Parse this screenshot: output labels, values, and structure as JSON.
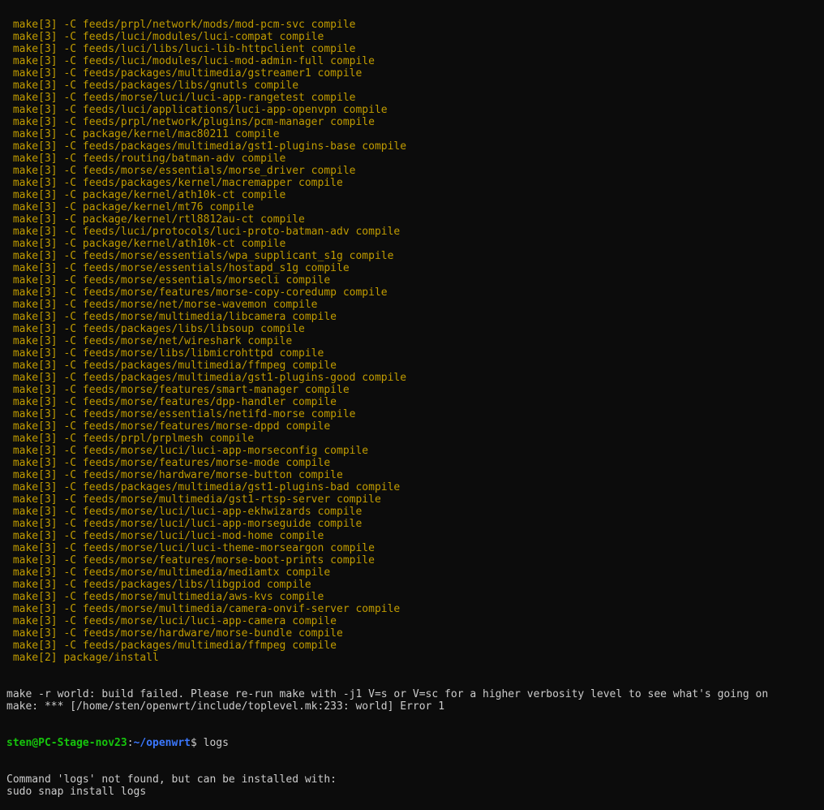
{
  "terminal": {
    "build_lines": [
      " make[3] -C feeds/prpl/network/mods/mod-pcm-svc compile",
      " make[3] -C feeds/luci/modules/luci-compat compile",
      " make[3] -C feeds/luci/libs/luci-lib-httpclient compile",
      " make[3] -C feeds/luci/modules/luci-mod-admin-full compile",
      " make[3] -C feeds/packages/multimedia/gstreamer1 compile",
      " make[3] -C feeds/packages/libs/gnutls compile",
      " make[3] -C feeds/morse/luci/luci-app-rangetest compile",
      " make[3] -C feeds/luci/applications/luci-app-openvpn compile",
      " make[3] -C feeds/prpl/network/plugins/pcm-manager compile",
      " make[3] -C package/kernel/mac80211 compile",
      " make[3] -C feeds/packages/multimedia/gst1-plugins-base compile",
      " make[3] -C feeds/routing/batman-adv compile",
      " make[3] -C feeds/morse/essentials/morse_driver compile",
      " make[3] -C feeds/packages/kernel/macremapper compile",
      " make[3] -C package/kernel/ath10k-ct compile",
      " make[3] -C package/kernel/mt76 compile",
      " make[3] -C package/kernel/rtl8812au-ct compile",
      " make[3] -C feeds/luci/protocols/luci-proto-batman-adv compile",
      " make[3] -C package/kernel/ath10k-ct compile",
      " make[3] -C feeds/morse/essentials/wpa_supplicant_s1g compile",
      " make[3] -C feeds/morse/essentials/hostapd_s1g compile",
      " make[3] -C feeds/morse/essentials/morsecli compile",
      " make[3] -C feeds/morse/features/morse-copy-coredump compile",
      " make[3] -C feeds/morse/net/morse-wavemon compile",
      " make[3] -C feeds/morse/multimedia/libcamera compile",
      " make[3] -C feeds/packages/libs/libsoup compile",
      " make[3] -C feeds/morse/net/wireshark compile",
      " make[3] -C feeds/morse/libs/libmicrohttpd compile",
      " make[3] -C feeds/packages/multimedia/ffmpeg compile",
      " make[3] -C feeds/packages/multimedia/gst1-plugins-good compile",
      " make[3] -C feeds/morse/features/smart-manager compile",
      " make[3] -C feeds/morse/features/dpp-handler compile",
      " make[3] -C feeds/morse/essentials/netifd-morse compile",
      " make[3] -C feeds/morse/features/morse-dppd compile",
      " make[3] -C feeds/prpl/prplmesh compile",
      " make[3] -C feeds/morse/luci/luci-app-morseconfig compile",
      " make[3] -C feeds/morse/features/morse-mode compile",
      " make[3] -C feeds/morse/hardware/morse-button compile",
      " make[3] -C feeds/packages/multimedia/gst1-plugins-bad compile",
      " make[3] -C feeds/morse/multimedia/gst1-rtsp-server compile",
      " make[3] -C feeds/morse/luci/luci-app-ekhwizards compile",
      " make[3] -C feeds/morse/luci/luci-app-morseguide compile",
      " make[3] -C feeds/morse/luci/luci-mod-home compile",
      " make[3] -C feeds/morse/luci/luci-theme-morseargon compile",
      " make[3] -C feeds/morse/features/morse-boot-prints compile",
      " make[3] -C feeds/morse/multimedia/mediamtx compile",
      " make[3] -C feeds/packages/libs/libgpiod compile",
      " make[3] -C feeds/morse/multimedia/aws-kvs compile",
      " make[3] -C feeds/morse/multimedia/camera-onvif-server compile",
      " make[3] -C feeds/morse/luci/luci-app-camera compile",
      " make[3] -C feeds/morse/hardware/morse-bundle compile",
      " make[3] -C feeds/packages/multimedia/ffmpeg compile",
      " make[2] package/install"
    ],
    "error_lines": [
      "make -r world: build failed. Please re-run make with -j1 V=s or V=sc for a higher verbosity level to see what's going on",
      "make: *** [/home/sten/openwrt/include/toplevel.mk:233: world] Error 1"
    ],
    "prompt": {
      "user_host": "sten@PC-Stage-nov23",
      "separator": ":",
      "path": "~/openwrt",
      "symbol": "$ ",
      "command": "logs"
    },
    "output_lines": [
      "Command 'logs' not found, but can be installed with:",
      "sudo snap install logs"
    ],
    "colors": {
      "background": "#0c0c0c",
      "build_text": "#c19c00",
      "plain_text": "#cccccc",
      "prompt_user": "#16c60c",
      "prompt_path": "#3b78ff"
    }
  }
}
